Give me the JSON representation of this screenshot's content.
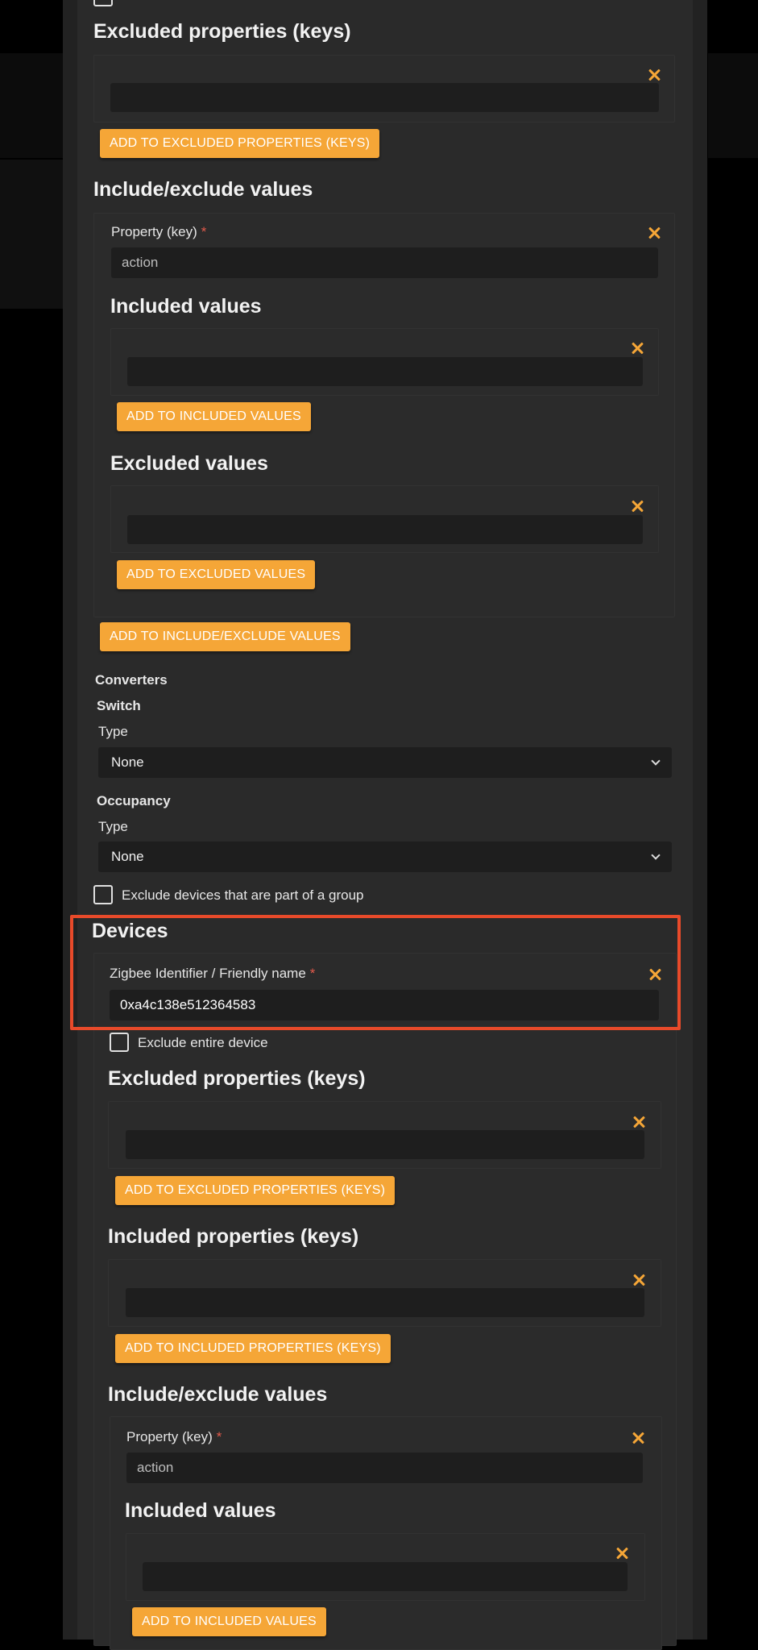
{
  "colors": {
    "accent": "#f5a637",
    "required": "#e25a4b",
    "highlight": "#e84a2a"
  },
  "icons": {
    "remove": "close-x-icon",
    "select": "chevron-down-icon"
  },
  "top_section": {
    "excluded_properties": {
      "heading": "Excluded properties (keys)",
      "input_value": "",
      "add_button": "ADD TO EXCLUDED PROPERTIES (KEYS)"
    },
    "include_exclude": {
      "heading": "Include/exclude values",
      "property_label": "Property (key)",
      "required_mark": "*",
      "property_value": "action",
      "included_values": {
        "heading": "Included values",
        "input_value": "",
        "add_button": "ADD TO INCLUDED VALUES"
      },
      "excluded_values": {
        "heading": "Excluded values",
        "input_value": "",
        "add_button": "ADD TO EXCLUDED VALUES"
      },
      "add_button": "ADD TO INCLUDE/EXCLUDE VALUES"
    }
  },
  "converters": {
    "heading": "Converters",
    "switch": {
      "heading": "Switch",
      "type_label": "Type",
      "value": "None"
    },
    "occupancy": {
      "heading": "Occupancy",
      "type_label": "Type",
      "value": "None"
    }
  },
  "exclude_group_label": "Exclude devices that are part of a group",
  "devices": {
    "heading": "Devices",
    "identifier_label": "Zigbee Identifier / Friendly name",
    "required_mark": "*",
    "identifier_value": "0xa4c138e512364583",
    "exclude_entire_label": "Exclude entire device",
    "excluded_properties": {
      "heading": "Excluded properties (keys)",
      "input_value": "",
      "add_button": "ADD TO EXCLUDED PROPERTIES (KEYS)"
    },
    "included_properties": {
      "heading": "Included properties (keys)",
      "input_value": "",
      "add_button": "ADD TO INCLUDED PROPERTIES (KEYS)"
    },
    "include_exclude": {
      "heading": "Include/exclude values",
      "property_label": "Property (key)",
      "required_mark": "*",
      "property_value": "action",
      "included_values": {
        "heading": "Included values",
        "input_value": "",
        "add_button": "ADD TO INCLUDED VALUES"
      }
    }
  }
}
